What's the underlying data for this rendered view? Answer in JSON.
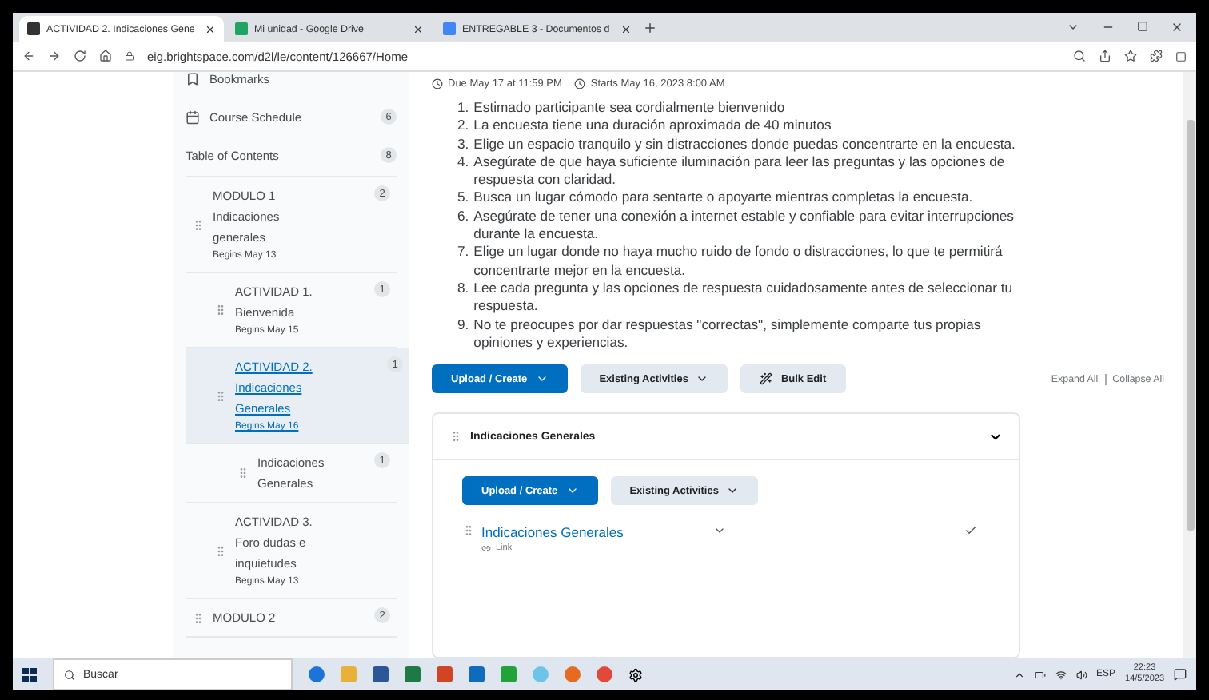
{
  "browser": {
    "tabs": [
      {
        "title": "ACTIVIDAD 2. Indicaciones Gene",
        "selected": true
      },
      {
        "title": "Mi unidad - Google Drive",
        "selected": false
      },
      {
        "title": "ENTREGABLE 3 - Documentos d",
        "selected": false
      }
    ],
    "url": "eig.brightspace.com/d2l/le/content/126667/Home"
  },
  "sidebar": {
    "links": [
      {
        "kind": "bookmarks",
        "label": "Bookmarks"
      },
      {
        "kind": "schedule",
        "label": "Course Schedule",
        "count": "6"
      }
    ],
    "toc": {
      "label": "Table of Contents",
      "count": "8"
    },
    "modules": [
      {
        "title": "MODULO 1 Indicaciones generales",
        "begins": "Begins May 13",
        "count": "2",
        "selected": false,
        "children": [
          {
            "title": "ACTIVIDAD 1. Bienvenida",
            "begins": "Begins May 15",
            "count": "1",
            "selected": false
          },
          {
            "title": "ACTIVIDAD 2. Indicaciones Generales",
            "begins": "Begins May 16",
            "count": "1",
            "selected": true,
            "children": [
              {
                "title": "Indicaciones Generales",
                "count": "1",
                "selected": false
              }
            ]
          },
          {
            "title": "ACTIVIDAD 3. Foro dudas e inquietudes",
            "begins": "Begins May 13",
            "selected": false
          }
        ]
      },
      {
        "title": "MODULO 2",
        "count": "2",
        "selected": false
      }
    ]
  },
  "main": {
    "due": "Due May 17 at 11:59 PM",
    "starts": "Starts May 16, 2023 8:00 AM",
    "instructions": [
      {
        "number": "1.",
        "text": "Estimado participante sea cordialmente bienvenido"
      },
      {
        "number": "2.",
        "text": "La encuesta tiene una duración aproximada de 40 minutos"
      },
      {
        "number": "3.",
        "text": "Elige un espacio tranquilo y sin distracciones donde puedas concentrarte en la encuesta."
      },
      {
        "number": "4.",
        "text": "Asegúrate de que haya suficiente iluminación para leer las preguntas y las opciones de respuesta con claridad."
      },
      {
        "number": "5.",
        "text": "Busca un lugar cómodo para sentarte o apoyarte mientras completas la encuesta."
      },
      {
        "number": "6.",
        "text": "Asegúrate de tener una conexión a internet estable y confiable para evitar interrupciones durante la encuesta."
      },
      {
        "number": "7.",
        "text": "Elige un lugar donde no haya mucho ruido de fondo o distracciones, lo que te permitirá concentrarte mejor en la encuesta."
      },
      {
        "number": "8.",
        "text": "Lee cada pregunta y las opciones de respuesta cuidadosamente antes de seleccionar tu respuesta."
      },
      {
        "number": "9.",
        "text": "No te preocupes por dar respuestas \"correctas\", simplemente comparte tus propias opiniones y experiencias."
      }
    ],
    "toolbar": [
      {
        "label": "Upload / Create",
        "kind": "primary"
      },
      {
        "label": "Existing Activities",
        "kind": "secondary"
      },
      {
        "label": "Bulk Edit",
        "kind": "bulk"
      }
    ],
    "expand_all": "Expand All",
    "collapse_all": "Collapse All",
    "section": {
      "title": "Indicaciones Generales",
      "expanded": true,
      "buttons": [
        {
          "label": "Upload / Create",
          "kind": "primary"
        },
        {
          "label": "Existing Activities",
          "kind": "secondary"
        }
      ],
      "items": [
        {
          "title": "Indicaciones Generales",
          "type": "Link",
          "completed": true
        }
      ]
    }
  },
  "taskbar": {
    "search_placeholder": "Buscar",
    "language": "ESP",
    "time": "22:23",
    "date": "14/5/2023"
  }
}
